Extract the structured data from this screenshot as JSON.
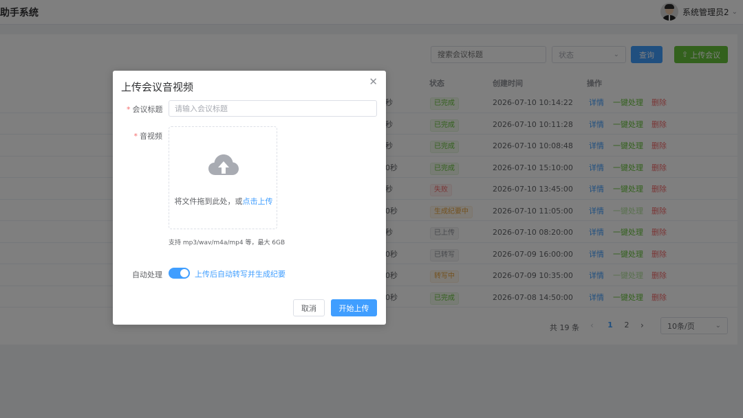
{
  "header": {
    "app_title": "助手系统",
    "user_name": "系统管理员2",
    "dropdown_icon": "chevron-down-icon"
  },
  "toolbar": {
    "search_placeholder": "搜索会议标题",
    "status_placeholder": "状态",
    "query_label": "查询",
    "upload_label": "上传会议",
    "upload_icon": "upload-arrow-icon"
  },
  "table": {
    "headers": {
      "status": "状态",
      "created": "创建时间",
      "actions": "操作"
    },
    "rows": [
      {
        "duration": "秒",
        "status": "已完成",
        "status_type": "success",
        "created": "2026-07-10 10:14:22",
        "process_disabled": false
      },
      {
        "duration": "秒",
        "status": "已完成",
        "status_type": "success",
        "created": "2026-07-10 10:11:28",
        "process_disabled": false
      },
      {
        "duration": "秒",
        "status": "已完成",
        "status_type": "success",
        "created": "2026-07-10 10:08:48",
        "process_disabled": false
      },
      {
        "duration": "0秒",
        "status": "已完成",
        "status_type": "success",
        "created": "2026-07-10 15:10:00",
        "process_disabled": false
      },
      {
        "duration": "秒",
        "status": "失败",
        "status_type": "danger",
        "created": "2026-07-10 13:45:00",
        "process_disabled": false
      },
      {
        "duration": "0秒",
        "status": "生成纪要中",
        "status_type": "warning",
        "created": "2026-07-10 11:05:00",
        "process_disabled": true
      },
      {
        "duration": "秒",
        "status": "已上传",
        "status_type": "info",
        "created": "2026-07-10 08:20:00",
        "process_disabled": false
      },
      {
        "duration": "0秒",
        "status": "已转写",
        "status_type": "info",
        "created": "2026-07-09 16:00:00",
        "process_disabled": false
      },
      {
        "duration": "0秒",
        "status": "转写中",
        "status_type": "warning",
        "created": "2026-07-09 10:35:00",
        "process_disabled": true
      },
      {
        "duration": "0秒",
        "status": "已完成",
        "status_type": "success",
        "created": "2026-07-08 14:50:00",
        "process_disabled": false
      }
    ],
    "action_labels": {
      "detail": "详情",
      "process": "一键处理",
      "delete": "删除"
    }
  },
  "pagination": {
    "total": "共 19 条",
    "pages": [
      "1",
      "2"
    ],
    "current_page": "1",
    "page_size": "10条/页"
  },
  "dialog": {
    "title": "上传会议音视频",
    "close_icon": "close-icon",
    "title_label": "会议标题",
    "title_placeholder": "请输入会议标题",
    "media_label": "音视频",
    "cloud_icon": "cloud-upload-icon",
    "drop_text": "将文件拖到此处，或",
    "drop_link": "点击上传",
    "tip": "支持 mp3/wav/m4a/mp4 等，最大 6GB",
    "auto_label": "自动处理",
    "auto_enabled": true,
    "auto_text": "上传后自动转写并生成纪要",
    "cancel_label": "取消",
    "start_label": "开始上传"
  },
  "colors": {
    "primary": "#409eff",
    "success": "#67c23a",
    "danger": "#f56c6c",
    "warning": "#e6a23c"
  }
}
